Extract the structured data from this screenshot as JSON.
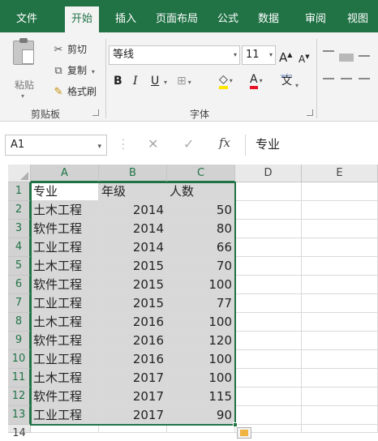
{
  "ribbon_tabs": [
    "文件",
    "开始",
    "插入",
    "页面布局",
    "公式",
    "数据",
    "审阅",
    "视图"
  ],
  "active_tab": "开始",
  "colors": {
    "brand": "#217346",
    "selection_fill": "#d8d8d8",
    "font_color_bar": "#e81123",
    "highlight_bar": "#ffe500"
  },
  "clipboard": {
    "paste_label": "粘贴",
    "cut_label": "剪切",
    "copy_label": "复制",
    "copy_dropdown": "▾",
    "format_painter_label": "格式刷",
    "group_label": "剪贴板",
    "icons": {
      "paste": "clipboard-icon",
      "cut": "scissors-icon",
      "copy": "copy-icon",
      "format_painter": "paintbrush-icon"
    }
  },
  "font": {
    "font_name": "等线",
    "font_size": "11",
    "bold": "B",
    "italic": "I",
    "underline": "U",
    "grow": "A",
    "shrink": "A",
    "font_color_label": "A",
    "phonetic_label": "wén",
    "phonetic_glyph": "文",
    "group_label": "字体",
    "icons": {
      "border": "border-icon",
      "fill": "fill-color-icon"
    }
  },
  "formula_bar": {
    "name_box": "A1",
    "cancel": "✕",
    "enter": "✓",
    "fx": "fx",
    "value": "专业"
  },
  "columns": [
    "A",
    "B",
    "C",
    "D",
    "E"
  ],
  "rows": [
    {
      "n": "1",
      "a": "专业",
      "b": "年级",
      "c": "人数"
    },
    {
      "n": "2",
      "a": "土木工程",
      "b": "2014",
      "c": "50"
    },
    {
      "n": "3",
      "a": "软件工程",
      "b": "2014",
      "c": "80"
    },
    {
      "n": "4",
      "a": "工业工程",
      "b": "2014",
      "c": "66"
    },
    {
      "n": "5",
      "a": "土木工程",
      "b": "2015",
      "c": "70"
    },
    {
      "n": "6",
      "a": "软件工程",
      "b": "2015",
      "c": "100"
    },
    {
      "n": "7",
      "a": "工业工程",
      "b": "2015",
      "c": "77"
    },
    {
      "n": "8",
      "a": "土木工程",
      "b": "2016",
      "c": "100"
    },
    {
      "n": "9",
      "a": "软件工程",
      "b": "2016",
      "c": "120"
    },
    {
      "n": "10",
      "a": "工业工程",
      "b": "2016",
      "c": "100"
    },
    {
      "n": "11",
      "a": "土木工程",
      "b": "2017",
      "c": "100"
    },
    {
      "n": "12",
      "a": "软件工程",
      "b": "2017",
      "c": "115"
    },
    {
      "n": "13",
      "a": "工业工程",
      "b": "2017",
      "c": "90"
    }
  ],
  "next_row_label": "14"
}
